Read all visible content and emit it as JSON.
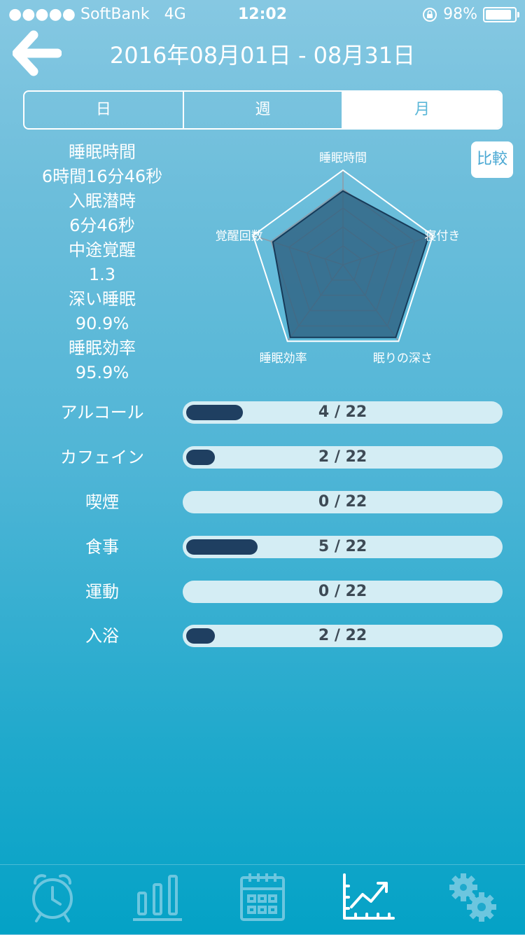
{
  "status_bar": {
    "carrier": "●●●●● SoftBank",
    "network": "4G",
    "time": "12:02",
    "battery": "98%"
  },
  "header": {
    "title": "2016年08月01日 - 08月31日"
  },
  "segments": {
    "day": "日",
    "week": "週",
    "month": "月",
    "selected": "月"
  },
  "stats": [
    {
      "label": "睡眠時間",
      "value": "6時間16分46秒"
    },
    {
      "label": "入眠潜時",
      "value": "6分46秒"
    },
    {
      "label": "中途覚醒",
      "value": "1.3"
    },
    {
      "label": "深い睡眠",
      "value": "90.9%"
    },
    {
      "label": "睡眠効率",
      "value": "95.9%"
    }
  ],
  "compare_button": "比較",
  "radar": {
    "axes": [
      "睡眠時間",
      "寝付き",
      "眠りの深さ",
      "睡眠効率",
      "覚醒回数"
    ],
    "values": [
      0.78,
      0.95,
      0.95,
      0.95,
      0.78
    ],
    "max": 1
  },
  "habits": [
    {
      "name": "アルコール",
      "count": 4,
      "total": 22,
      "text": "4 / 22"
    },
    {
      "name": "カフェイン",
      "count": 2,
      "total": 22,
      "text": "2 / 22"
    },
    {
      "name": "喫煙",
      "count": 0,
      "total": 22,
      "text": "0 / 22"
    },
    {
      "name": "食事",
      "count": 5,
      "total": 22,
      "text": "5 / 22"
    },
    {
      "name": "運動",
      "count": 0,
      "total": 22,
      "text": "0 / 22"
    },
    {
      "name": "入浴",
      "count": 2,
      "total": 22,
      "text": "2 / 22"
    }
  ],
  "tabbar": {
    "icons": [
      "alarm-clock-icon",
      "bar-chart-icon",
      "calendar-icon",
      "trend-chart-icon",
      "gears-icon"
    ],
    "active": "trend-chart-icon"
  },
  "colors": {
    "bar_fill": "#1f3f61",
    "bar_track": "#d4edf4",
    "radar_fill": "#2d5e7e",
    "accent": "#4aa8d3"
  }
}
